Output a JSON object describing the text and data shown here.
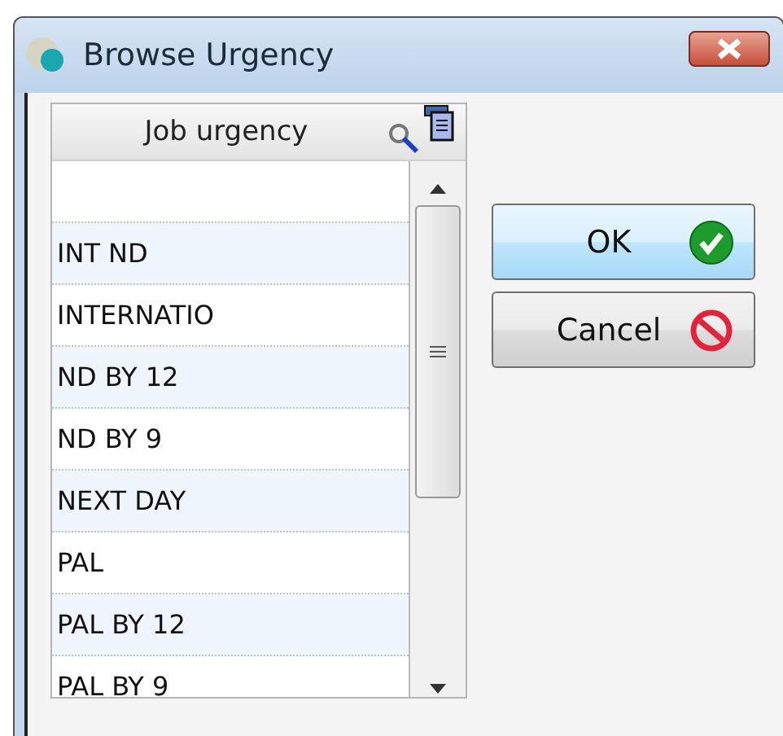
{
  "window": {
    "title": "Browse Urgency"
  },
  "table": {
    "column": "Job urgency",
    "rows": [
      "INT ND",
      "INTERNATIO",
      "ND BY 12",
      "ND BY 9",
      "NEXT DAY",
      "PAL",
      "PAL BY 12",
      "PAL BY 9"
    ]
  },
  "buttons": [
    {
      "label": "OK",
      "kind": "ok"
    },
    {
      "label": "Cancel",
      "kind": "cancel"
    }
  ]
}
